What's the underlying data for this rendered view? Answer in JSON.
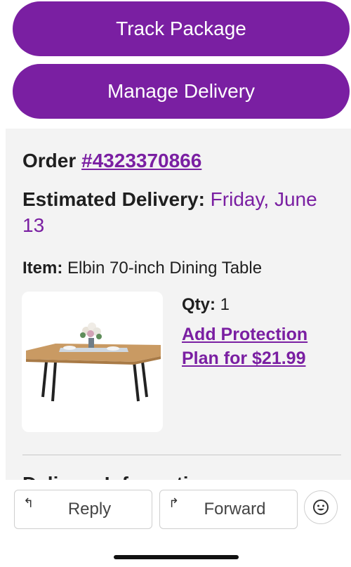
{
  "actions": {
    "track_label": "Track Package",
    "manage_label": "Manage Delivery"
  },
  "order": {
    "order_label": "Order",
    "order_number": "#4323370866",
    "eta_label": "Estimated Delivery:",
    "eta_value": "Friday, June 13",
    "item_label": "Item:",
    "item_name": "Elbin 70-inch Dining Table",
    "qty_label": "Qty:",
    "qty_value": "1",
    "protection_link": "Add Protection Plan for $21.99",
    "next_section": "Delivery Information:"
  },
  "footer": {
    "reply_label": "Reply",
    "forward_label": "Forward"
  },
  "colors": {
    "accent": "#7a1fa2",
    "panel_bg": "#f3f3f3"
  },
  "icons": [
    "reply-icon",
    "forward-icon",
    "emoji-icon"
  ]
}
